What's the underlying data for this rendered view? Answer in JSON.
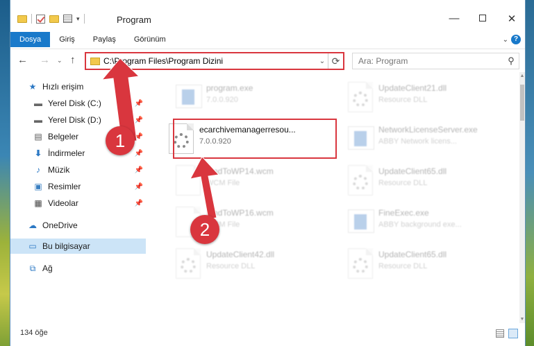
{
  "window": {
    "title": "Program",
    "minimize_glyph": "—",
    "close_glyph": "✕"
  },
  "ribbon": {
    "tabs": [
      {
        "label": "Dosya"
      },
      {
        "label": "Giriş"
      },
      {
        "label": "Paylaş"
      },
      {
        "label": "Görünüm"
      }
    ],
    "help_glyph": "?"
  },
  "address": {
    "path": "C:\\Program Files\\Program Dizini"
  },
  "search": {
    "placeholder": "Ara: Program"
  },
  "sidebar": {
    "items": [
      {
        "label": "Hızlı erişim",
        "icon": "star-icon"
      },
      {
        "label": "Yerel Disk (C:)",
        "icon": "drive-icon"
      },
      {
        "label": "Yerel Disk (D:)",
        "icon": "drive-icon"
      },
      {
        "label": "Belgeler",
        "icon": "document-icon"
      },
      {
        "label": "İndirmeler",
        "icon": "download-icon"
      },
      {
        "label": "Müzik",
        "icon": "music-icon"
      },
      {
        "label": "Resimler",
        "icon": "pictures-icon"
      },
      {
        "label": "Videolar",
        "icon": "video-icon"
      },
      {
        "label": "OneDrive",
        "icon": "cloud-icon"
      },
      {
        "label": "Bu bilgisayar",
        "icon": "computer-icon"
      },
      {
        "label": "Ağ",
        "icon": "network-icon"
      }
    ]
  },
  "files": [
    {
      "name": "program.exe",
      "meta": "7.0.0.920"
    },
    {
      "name": "UpdateClient21.dll",
      "meta": "Resource DLL"
    },
    {
      "name": "ecarchivemanagerresou...",
      "meta": "7.0.0.920"
    },
    {
      "name": "NetworkLicenseServer.exe",
      "meta": "ABBY Network licens..."
    },
    {
      "name": "FindToWP14.wcm",
      "meta": "WCM File"
    },
    {
      "name": "UpdateClient65.dll",
      "meta": "Resource DLL"
    },
    {
      "name": "FindToWP16.wcm",
      "meta": "WCM File"
    },
    {
      "name": "FineExec.exe",
      "meta": "ABBY background exe..."
    },
    {
      "name": "UpdateClient42.dll",
      "meta": "Resource DLL"
    },
    {
      "name": "UpdateClient65.dll",
      "meta": "Resource DLL"
    }
  ],
  "status": {
    "count": "134 öğe"
  },
  "annotations": {
    "step1": "1",
    "step2": "2",
    "color": "#d9363e"
  }
}
